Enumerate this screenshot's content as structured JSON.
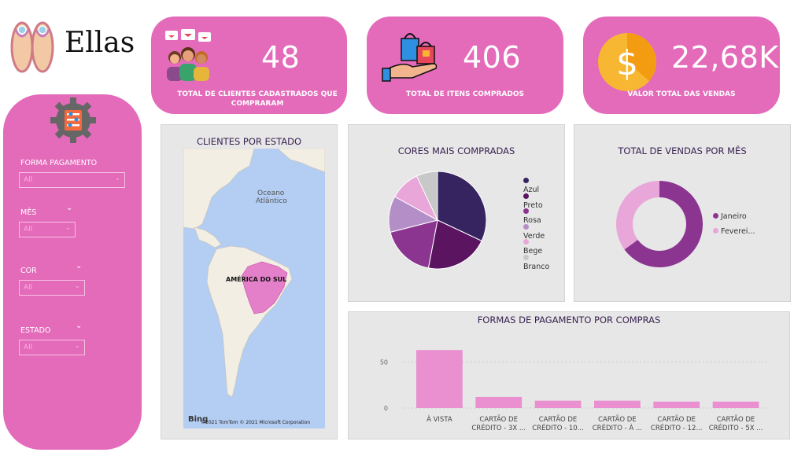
{
  "brand": {
    "name": "Ellas",
    "logo_icon": "flip-flops-icon"
  },
  "kpis": [
    {
      "value": "48",
      "label": "TOTAL DE CLIENTES CADASTRADOS QUE COMPRARAM",
      "icon": "customers-icon"
    },
    {
      "value": "406",
      "label": "TOTAL DE ITENS COMPRADOS",
      "icon": "shopping-bag-hand-icon"
    },
    {
      "value": "22,68K",
      "label": "VALOR TOTAL DAS VENDAS",
      "icon": "dollar-coin-icon"
    }
  ],
  "filters": {
    "icon": "settings-gear-icon",
    "forma_pagamento": {
      "label": "FORMA PAGAMENTO",
      "value": "All"
    },
    "mes": {
      "label": "MÊS",
      "value": "All"
    },
    "cor": {
      "label": "COR",
      "value": "All"
    },
    "estado": {
      "label": "ESTADO",
      "value": "All"
    }
  },
  "map": {
    "title": "CLIENTES POR ESTADO",
    "ocean_label_1": "Oceano",
    "ocean_label_2": "Atlântico",
    "region_label": "AMÉRICA DO SUL",
    "bing": "Bing",
    "copyright": "©2021 TomTom  © 2021 Microsoft Corporation"
  },
  "colors": {
    "kpi_bg": "#e46aba",
    "map_water": "#b3cdf3",
    "map_land": "#f2eee3",
    "map_highlight": "#e47fc9"
  },
  "chart_data": [
    {
      "type": "pie",
      "title": "CORES MAIS COMPRADAS",
      "categories": [
        "Azul",
        "Preto",
        "Rosa",
        "Verde",
        "Bege",
        "Branco"
      ],
      "values": [
        32,
        21,
        18,
        12,
        10,
        7
      ],
      "colors": [
        "#352460",
        "#5b1460",
        "#8b3591",
        "#b48ec6",
        "#e9a6d8",
        "#c8c8c8"
      ],
      "legend": "right"
    },
    {
      "type": "pie",
      "donut": true,
      "title": "TOTAL DE VENDAS POR MÊS",
      "categories": [
        "Janeiro",
        "Feverei..."
      ],
      "values": [
        65,
        35
      ],
      "colors": [
        "#8b3591",
        "#e9a6d8"
      ],
      "legend": "right"
    },
    {
      "type": "bar",
      "title": "FORMAS DE PAGAMENTO POR COMPRAS",
      "categories": [
        "À VISTA",
        "CARTÃO DE CRÉDITO - 3X ...",
        "CARTÃO DE CRÉDITO - 10...",
        "CARTÃO DE CRÉDITO - À ...",
        "CARTÃO DE CRÉDITO - 12...",
        "CARTÃO DE CRÉDITO - 5X ..."
      ],
      "values": [
        63,
        12,
        8,
        8,
        7,
        7
      ],
      "color": "#ea8fd0",
      "yticks": [
        0,
        50
      ],
      "ylim": [
        0,
        70
      ],
      "grid": true
    }
  ]
}
